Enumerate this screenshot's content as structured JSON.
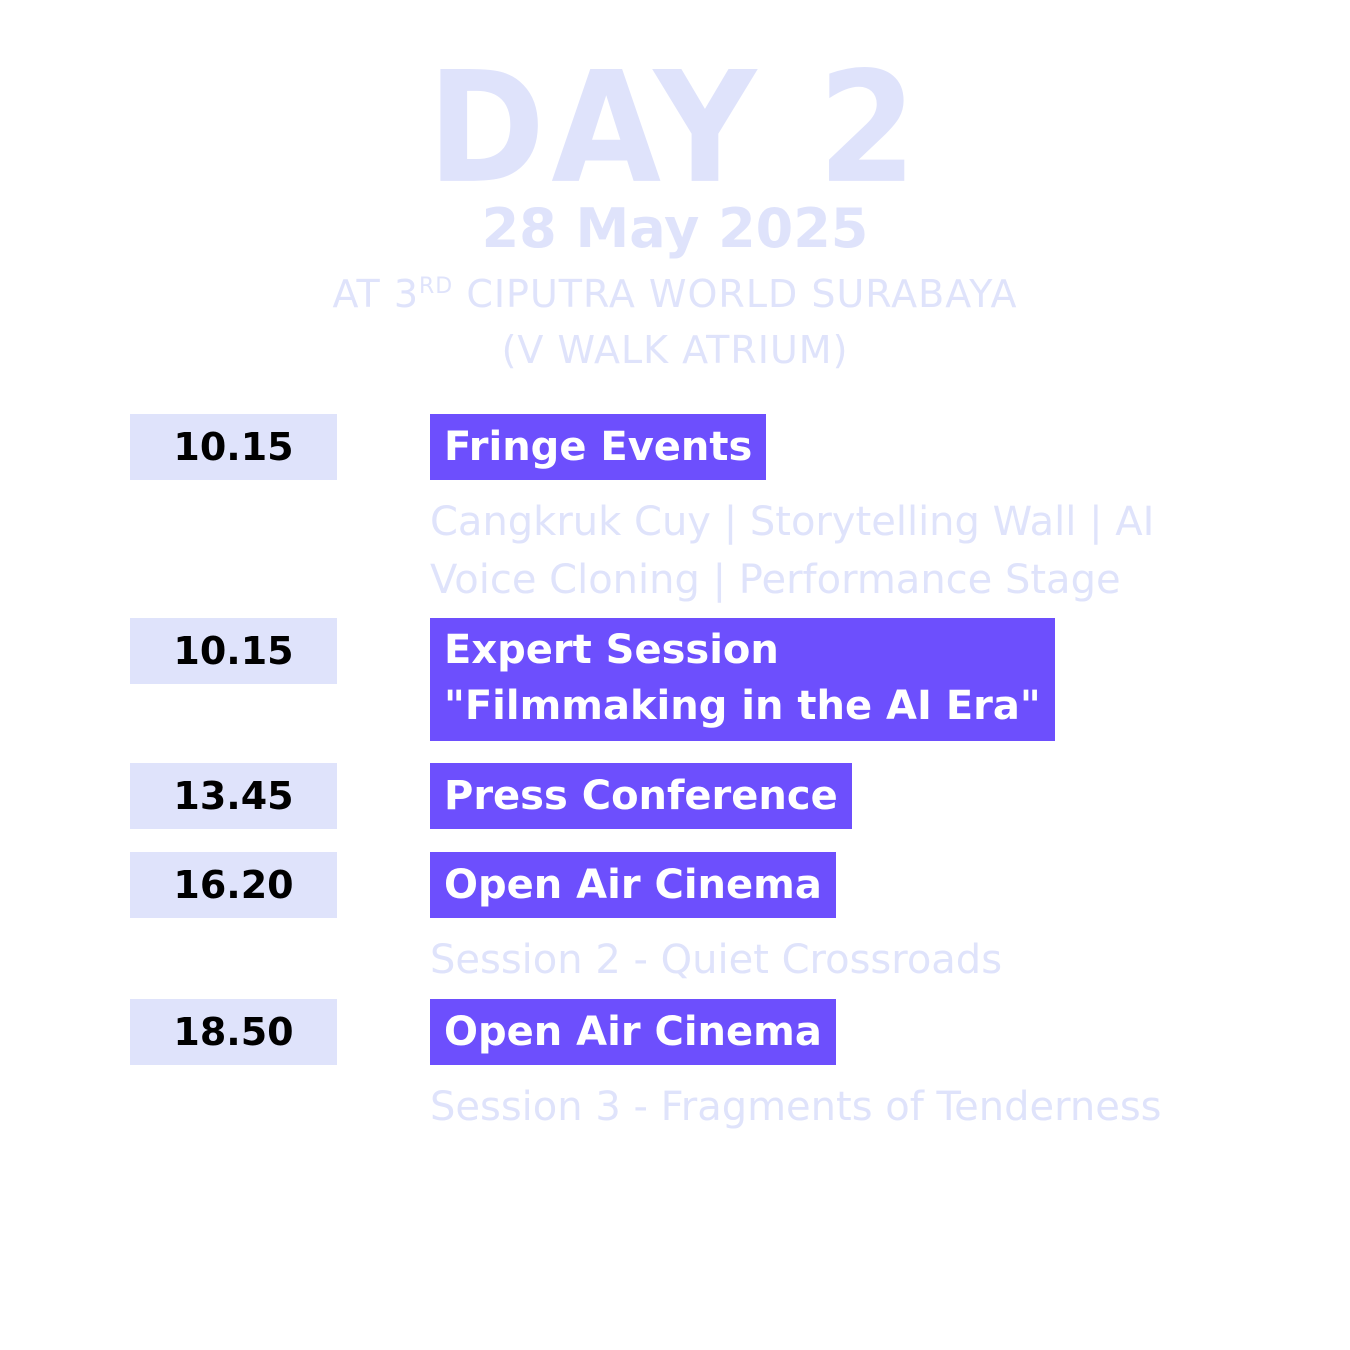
{
  "header": {
    "title": "DAY 2",
    "date": "28 May 2025",
    "venue_prefix": "AT 3",
    "venue_sup": "RD",
    "venue_rest": " CIPUTRA WORLD SURABAYA",
    "venue_line2": "(V WALK ATRIUM)"
  },
  "schedule": [
    {
      "time": "10.15",
      "event": "Fringe Events",
      "details": [
        "Cangkruk Cuy | Storytelling Wall | AI",
        "Voice Cloning | Performance Stage"
      ]
    },
    {
      "time": "10.15",
      "event_lines": [
        "Expert Session",
        "\"Filmmaking in the AI Era\""
      ]
    },
    {
      "time": "13.45",
      "event": "Press Conference"
    },
    {
      "time": "16.20",
      "event": "Open Air Cinema",
      "details": [
        "Session 2 - Quiet Crossroads"
      ]
    },
    {
      "time": "18.50",
      "event": "Open Air Cinema",
      "details": [
        "Session 3 - Fragments of Tenderness"
      ]
    }
  ],
  "colors": {
    "accent": "#6d4ffd",
    "pale": "#dfe3fb",
    "background": "#ffffff"
  }
}
